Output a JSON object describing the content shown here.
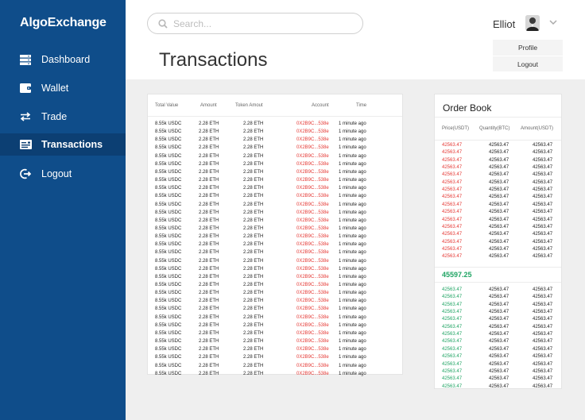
{
  "sidebar": {
    "brand": "AlgoExchange",
    "items": [
      {
        "label": "Dashboard",
        "icon": "server-icon",
        "active": false
      },
      {
        "label": "Wallet",
        "icon": "wallet-icon",
        "active": false
      },
      {
        "label": "Trade",
        "icon": "swap-icon",
        "active": false
      },
      {
        "label": "Transactions",
        "icon": "receipt-icon",
        "active": true
      },
      {
        "label": "Logout",
        "icon": "logout-icon",
        "active": false
      }
    ]
  },
  "header": {
    "search_placeholder": "Search...",
    "user_name": "Elliot",
    "page_title": "Transactions",
    "dropdown": [
      "Profile",
      "Logout"
    ]
  },
  "transactions": {
    "columns": [
      "Total Value",
      "Amount",
      "Token Amout",
      "Account",
      "Time"
    ],
    "rows": [
      [
        "8.55k USDC",
        "2.28 ETH",
        "2.28 ETH",
        "0X2B9C...538e",
        "1 minute ago"
      ],
      [
        "8.55k USDC",
        "2.28 ETH",
        "2.28 ETH",
        "0X2B9C...538e",
        "1 minute ago"
      ],
      [
        "8.55k USDC",
        "2.28 ETH",
        "2.28 ETH",
        "0X2B9C...538e",
        "1 minute ago"
      ],
      [
        "8.55k USDC",
        "2.28 ETH",
        "2.28 ETH",
        "0X2B9C...538e",
        "1 minute ago"
      ],
      [
        "8.55k USDC",
        "2.28 ETH",
        "2.28 ETH",
        "0X2B9C...538e",
        "1 minute ago"
      ],
      [
        "8.55k USDC",
        "2.28 ETH",
        "2.28 ETH",
        "0X2B9C...538e",
        "1 minute ago"
      ],
      [
        "8.55k USDC",
        "2.28 ETH",
        "2.28 ETH",
        "0X2B9C...538e",
        "1 minute ago"
      ],
      [
        "8.55k USDC",
        "2.28 ETH",
        "2.28 ETH",
        "0X2B9C...538e",
        "1 minute ago"
      ],
      [
        "8.55k USDC",
        "2.28 ETH",
        "2.28 ETH",
        "0X2B9C...538e",
        "1 minute ago"
      ],
      [
        "8.55k USDC",
        "2.28 ETH",
        "2.28 ETH",
        "0X2B9C...538e",
        "1 minute ago"
      ],
      [
        "8.55k USDC",
        "2.28 ETH",
        "2.28 ETH",
        "0X2B9C...538e",
        "1 minute ago"
      ],
      [
        "8.55k USDC",
        "2.28 ETH",
        "2.28 ETH",
        "0X2B9C...538e",
        "1 minute ago"
      ],
      [
        "8.55k USDC",
        "2.28 ETH",
        "2.28 ETH",
        "0X2B9C...538e",
        "1 minute ago"
      ],
      [
        "8.55k USDC",
        "2.28 ETH",
        "2.28 ETH",
        "0X2B9C...538e",
        "1 minute ago"
      ],
      [
        "8.55k USDC",
        "2.28 ETH",
        "2.28 ETH",
        "0X2B9C...538e",
        "1 minute ago"
      ],
      [
        "8.55k USDC",
        "2.28 ETH",
        "2.28 ETH",
        "0X2B9C...538e",
        "1 minute ago"
      ],
      [
        "8.55k USDC",
        "2.28 ETH",
        "2.28 ETH",
        "0X2B9C...538e",
        "1 minute ago"
      ],
      [
        "8.55k USDC",
        "2.28 ETH",
        "2.28 ETH",
        "0X2B9C...538e",
        "1 minute ago"
      ],
      [
        "8.55k USDC",
        "2.28 ETH",
        "2.28 ETH",
        "0X2B9C...538e",
        "1 minute ago"
      ],
      [
        "8.55k USDC",
        "2.28 ETH",
        "2.28 ETH",
        "0X2B9C...538e",
        "1 minute ago"
      ],
      [
        "8.55k USDC",
        "2.28 ETH",
        "2.28 ETH",
        "0X2B9C...538e",
        "1 minute ago"
      ],
      [
        "8.55k USDC",
        "2.28 ETH",
        "2.28 ETH",
        "0X2B9C...538e",
        "1 minute ago"
      ],
      [
        "8.55k USDC",
        "2.28 ETH",
        "2.28 ETH",
        "0X2B9C...538e",
        "1 minute ago"
      ],
      [
        "8.55k USDC",
        "2.28 ETH",
        "2.28 ETH",
        "0X2B9C...538e",
        "1 minute ago"
      ],
      [
        "8.55k USDC",
        "2.28 ETH",
        "2.28 ETH",
        "0X2B9C...538e",
        "1 minute ago"
      ],
      [
        "8.55k USDC",
        "2.28 ETH",
        "2.28 ETH",
        "0X2B9C...538e",
        "1 minute ago"
      ],
      [
        "8.55k USDC",
        "2.28 ETH",
        "2.28 ETH",
        "0X2B9C...538e",
        "1 minute ago"
      ],
      [
        "8.55k USDC",
        "2.28 ETH",
        "2.28 ETH",
        "0X2B9C...538e",
        "1 minute ago"
      ],
      [
        "8.55k USDC",
        "2.28 ETH",
        "2.28 ETH",
        "0X2B9C...538e",
        "1 minute ago"
      ],
      [
        "8.55k USDC",
        "2.28 ETH",
        "2.28 ETH",
        "0X2B9C...538e",
        "1 minute ago"
      ],
      [
        "8.55k USDC",
        "2.28 ETH",
        "2.28 ETH",
        "0X2B9C...538e",
        "1 minute ago"
      ],
      [
        "8.55k USDC",
        "2.28 ETH",
        "2.28 ETH",
        "0X2B9C...538e",
        "1 minute ago"
      ]
    ]
  },
  "order_book": {
    "title": "Order Book",
    "columns": [
      "Price(USDT)",
      "Quantity(BTC)",
      "Amount(USDT)"
    ],
    "sell_rows": [
      [
        "42563.47",
        "42563.47",
        "42563.47"
      ],
      [
        "42563.47",
        "42563.47",
        "42563.47"
      ],
      [
        "42563.47",
        "42563.47",
        "42563.47"
      ],
      [
        "42563.47",
        "42563.47",
        "42563.47"
      ],
      [
        "42563.47",
        "42563.47",
        "42563.47"
      ],
      [
        "42563.47",
        "42563.47",
        "42563.47"
      ],
      [
        "42563.47",
        "42563.47",
        "42563.47"
      ],
      [
        "42563.47",
        "42563.47",
        "42563.47"
      ],
      [
        "42563.47",
        "42563.47",
        "42563.47"
      ],
      [
        "42563.47",
        "42563.47",
        "42563.47"
      ],
      [
        "42563.47",
        "42563.47",
        "42563.47"
      ],
      [
        "42563.47",
        "42563.47",
        "42563.47"
      ],
      [
        "42563.47",
        "42563.47",
        "42563.47"
      ],
      [
        "42563.47",
        "42563.47",
        "42563.47"
      ],
      [
        "42563.47",
        "42563.47",
        "42563.47"
      ],
      [
        "42563.47",
        "42563.47",
        "42563.47"
      ]
    ],
    "mid_price": "45597.25",
    "buy_rows": [
      [
        "42563.47",
        "42563.47",
        "42563.47"
      ],
      [
        "42563.47",
        "42563.47",
        "42563.47"
      ],
      [
        "42563.47",
        "42563.47",
        "42563.47"
      ],
      [
        "42563.47",
        "42563.47",
        "42563.47"
      ],
      [
        "42563.47",
        "42563.47",
        "42563.47"
      ],
      [
        "42563.47",
        "42563.47",
        "42563.47"
      ],
      [
        "42563.47",
        "42563.47",
        "42563.47"
      ],
      [
        "42563.47",
        "42563.47",
        "42563.47"
      ],
      [
        "42563.47",
        "42563.47",
        "42563.47"
      ],
      [
        "42563.47",
        "42563.47",
        "42563.47"
      ],
      [
        "42563.47",
        "42563.47",
        "42563.47"
      ],
      [
        "42563.47",
        "42563.47",
        "42563.47"
      ],
      [
        "42563.47",
        "42563.47",
        "42563.47"
      ],
      [
        "42563.47",
        "42563.47",
        "42563.47"
      ]
    ]
  },
  "colors": {
    "sidebar": "#0f4d8a",
    "sidebar_active": "#0c3f73",
    "sell": "#e53935",
    "buy": "#1fa463"
  }
}
